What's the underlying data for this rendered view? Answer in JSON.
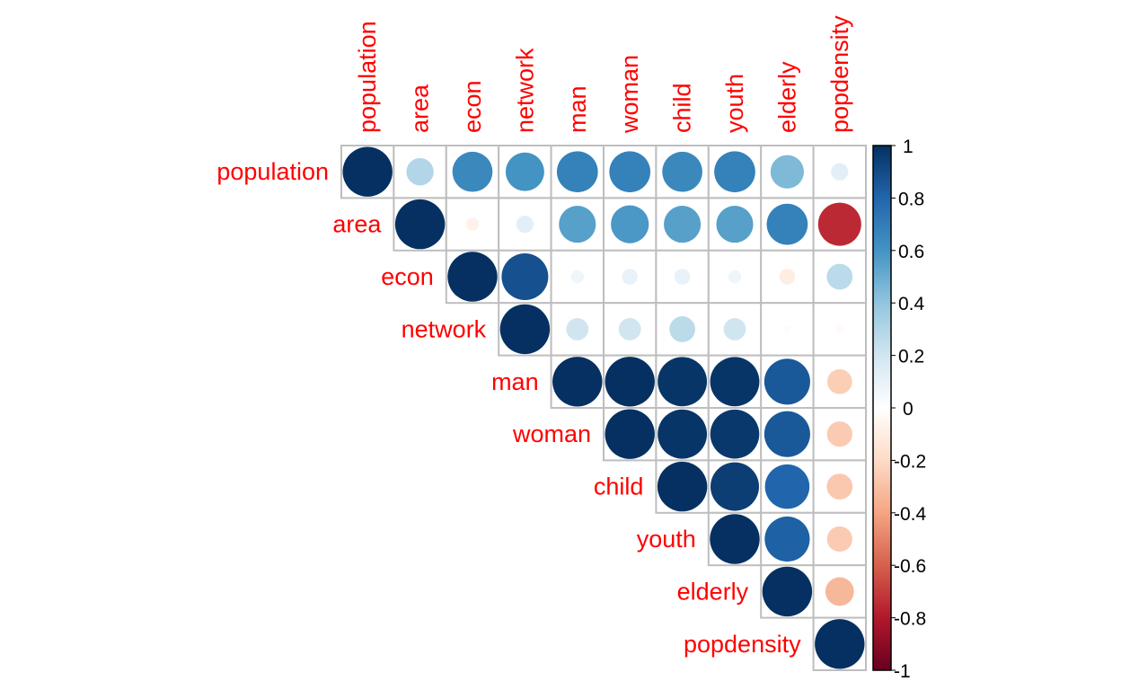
{
  "chart_data": {
    "type": "heatmap",
    "subtype": "corrplot-circle-upper",
    "title": "",
    "variables": [
      "population",
      "area",
      "econ",
      "network",
      "man",
      "woman",
      "child",
      "youth",
      "elderly",
      "popdensity"
    ],
    "matrix": [
      [
        1.0,
        0.3,
        0.65,
        0.6,
        0.68,
        0.68,
        0.65,
        0.68,
        0.45,
        0.12
      ],
      [
        0.3,
        1.0,
        -0.07,
        0.12,
        0.55,
        0.58,
        0.55,
        0.55,
        0.68,
        -0.75
      ],
      [
        0.65,
        -0.07,
        1.0,
        0.88,
        0.07,
        0.1,
        0.1,
        0.07,
        -0.1,
        0.27
      ],
      [
        0.6,
        0.12,
        0.88,
        1.0,
        0.2,
        0.2,
        0.27,
        0.2,
        -0.02,
        -0.03
      ],
      [
        0.68,
        0.55,
        0.07,
        0.2,
        1.0,
        1.0,
        0.98,
        0.98,
        0.85,
        -0.25
      ],
      [
        0.68,
        0.58,
        0.1,
        0.2,
        1.0,
        1.0,
        0.98,
        0.97,
        0.85,
        -0.26
      ],
      [
        0.65,
        0.55,
        0.1,
        0.27,
        0.98,
        0.98,
        1.0,
        0.95,
        0.8,
        -0.27
      ],
      [
        0.68,
        0.55,
        0.07,
        0.2,
        0.98,
        0.97,
        0.95,
        1.0,
        0.82,
        -0.26
      ],
      [
        0.45,
        0.68,
        -0.1,
        -0.02,
        0.85,
        0.85,
        0.8,
        0.82,
        1.0,
        -0.33
      ],
      [
        0.12,
        -0.75,
        0.27,
        -0.03,
        -0.25,
        -0.26,
        -0.27,
        -0.26,
        -0.33,
        1.0
      ]
    ],
    "display": "upper triangle including diagonal",
    "label_color": "#ff0000",
    "grid_color": "#bebebe",
    "colorbar": {
      "range": [
        -1,
        1
      ],
      "ticks": [
        "1",
        "0.8",
        "0.6",
        "0.4",
        "0.2",
        "0",
        "-0.2",
        "-0.4",
        "-0.6",
        "-0.8",
        "-1"
      ],
      "tick_values": [
        1,
        0.8,
        0.6,
        0.4,
        0.2,
        0,
        -0.2,
        -0.4,
        -0.6,
        -0.8,
        -1
      ],
      "colors": [
        "#67001F",
        "#B2182B",
        "#D6604D",
        "#F4A582",
        "#FDDBC7",
        "#FFFFFF",
        "#D1E5F0",
        "#92C5DE",
        "#4393C3",
        "#2166AC",
        "#053061"
      ],
      "position": "right"
    }
  }
}
